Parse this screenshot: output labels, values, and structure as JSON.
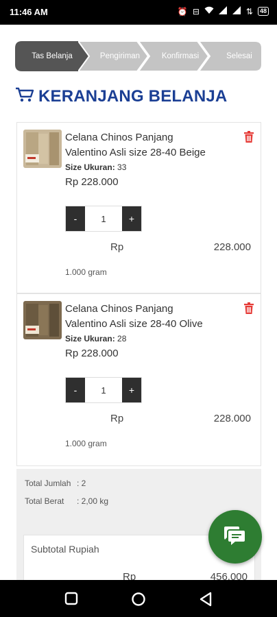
{
  "status_bar": {
    "time": "11:46 AM",
    "battery": "48"
  },
  "checkout_steps": [
    {
      "label": "Tas Belanja",
      "active": true
    },
    {
      "label": "Pengiriman",
      "active": false
    },
    {
      "label": "Konfirmasi",
      "active": false
    },
    {
      "label": "Selesai",
      "active": false
    }
  ],
  "page": {
    "title": "KERANJANG BELANJA"
  },
  "cart_items": [
    {
      "name_line1": "Celana Chinos Panjang",
      "name_line2": "Valentino Asli size 28-40 Beige",
      "size_label": "Size Ukuran:",
      "size_value": "33",
      "price": "Rp  228.000",
      "minus": "-",
      "quantity": "1",
      "plus": "+",
      "line_currency": "Rp",
      "line_total": "228.000",
      "weight": "1.000 gram"
    },
    {
      "name_line1": "Celana Chinos Panjang",
      "name_line2": "Valentino Asli size 28-40 Olive",
      "size_label": "Size Ukuran:",
      "size_value": "28",
      "price": "Rp  228.000",
      "minus": "-",
      "quantity": "1",
      "plus": "+",
      "line_currency": "Rp",
      "line_total": "228.000",
      "weight": "1.000 gram"
    }
  ],
  "summary": {
    "total_qty_label": "Total Jumlah",
    "total_qty_value": ": 2",
    "total_weight_label": "Total Berat",
    "total_weight_value": ": 2,00 kg",
    "subtotal_label": "Subtotal Rupiah",
    "subtotal_currency": "Rp",
    "subtotal_value": "456.000"
  },
  "colors": {
    "accent_title": "#1b3f94",
    "step_active": "#555555",
    "step_inactive": "#c4c4c4",
    "delete_red": "#e53935",
    "fab_green": "#2e7d32"
  },
  "icons": [
    "cart-icon",
    "trash-icon",
    "chat-icon",
    "alarm-icon",
    "wifi-icon",
    "signal-icon",
    "back-nav-icon",
    "home-nav-icon",
    "recents-nav-icon"
  ]
}
